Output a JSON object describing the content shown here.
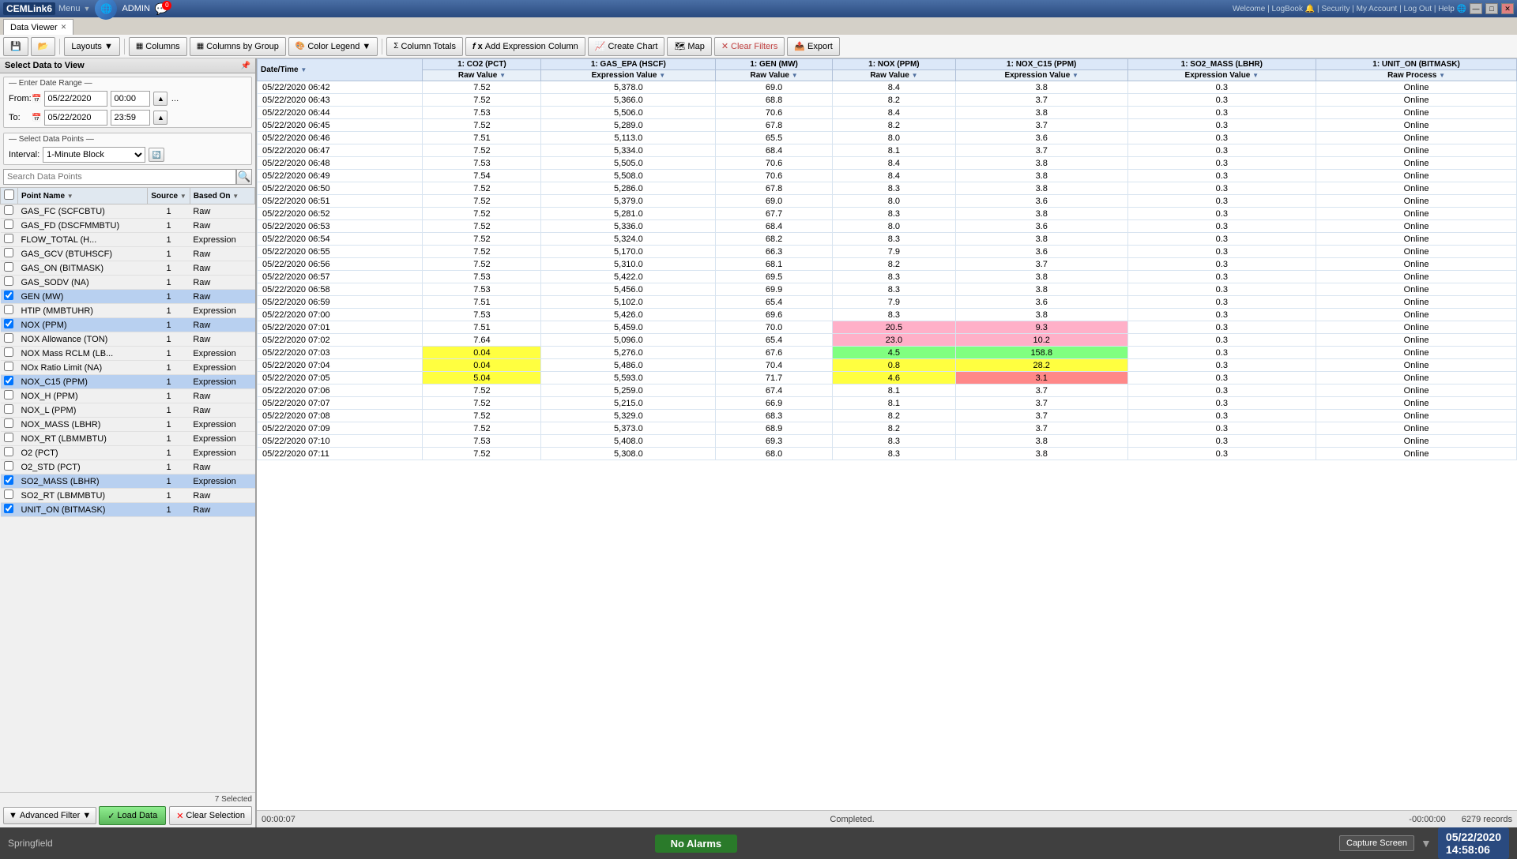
{
  "titlebar": {
    "app_name": "CEMLink6",
    "menu_label": "Menu",
    "user": "ADMIN",
    "notifications": "0",
    "welcome_links": "Welcome | LogBook 🔔 | Security | My Account | Log Out | Help 🌐",
    "min_btn": "—",
    "max_btn": "□",
    "close_btn": "✕"
  },
  "tab": {
    "label": "Data Viewer",
    "close": "✕"
  },
  "toolbar": {
    "layouts_label": "Layouts",
    "columns_label": "Columns",
    "columns_by_group_label": "Columns by Group",
    "color_legend_label": "Color Legend",
    "column_totals_label": "Column Totals",
    "add_expression_label": "Add Expression Column",
    "create_chart_label": "Create Chart",
    "map_label": "Map",
    "clear_filters_label": "Clear Filters",
    "export_label": "Export"
  },
  "left_panel": {
    "header": "Select Data to View",
    "date_range_label": "— Enter Date Range —",
    "from_label": "From:",
    "from_date": "05/22/2020",
    "from_time": "00:00",
    "to_label": "To:",
    "to_date": "05/22/2020",
    "to_time": "23:59",
    "select_dp_label": "— Select Data Points —",
    "interval_label": "Interval:",
    "interval_value": "1-Minute Block",
    "search_placeholder": "Search Data Points",
    "columns": {
      "point_name": "Point Name",
      "source": "Source",
      "based_on": "Based On"
    },
    "data_points": [
      {
        "name": "GAS_FC (SCFCBTU)",
        "source": "1",
        "based_on": "Raw",
        "selected": false
      },
      {
        "name": "GAS_FD (DSCFMMBTU)",
        "source": "1",
        "based_on": "Raw",
        "selected": false
      },
      {
        "name": "FLOW_TOTAL (H...",
        "source": "1",
        "based_on": "Expression",
        "selected": false
      },
      {
        "name": "GAS_GCV (BTUHSCF)",
        "source": "1",
        "based_on": "Raw",
        "selected": false
      },
      {
        "name": "GAS_ON (BITMASK)",
        "source": "1",
        "based_on": "Raw",
        "selected": false
      },
      {
        "name": "GAS_SODV (NA)",
        "source": "1",
        "based_on": "Raw",
        "selected": false
      },
      {
        "name": "GEN (MW)",
        "source": "1",
        "based_on": "Raw",
        "selected": true
      },
      {
        "name": "HTIP (MMBTUHR)",
        "source": "1",
        "based_on": "Expression",
        "selected": false
      },
      {
        "name": "NOX (PPM)",
        "source": "1",
        "based_on": "Raw",
        "selected": true
      },
      {
        "name": "NOX Allowance (TON)",
        "source": "1",
        "based_on": "Raw",
        "selected": false
      },
      {
        "name": "NOX Mass RCLM (LB...",
        "source": "1",
        "based_on": "Expression",
        "selected": false
      },
      {
        "name": "NOx Ratio Limit (NA)",
        "source": "1",
        "based_on": "Expression",
        "selected": false
      },
      {
        "name": "NOX_C15 (PPM)",
        "source": "1",
        "based_on": "Expression",
        "selected": true
      },
      {
        "name": "NOX_H (PPM)",
        "source": "1",
        "based_on": "Raw",
        "selected": false
      },
      {
        "name": "NOX_L (PPM)",
        "source": "1",
        "based_on": "Raw",
        "selected": false
      },
      {
        "name": "NOX_MASS (LBHR)",
        "source": "1",
        "based_on": "Expression",
        "selected": false
      },
      {
        "name": "NOX_RT (LBMMBTU)",
        "source": "1",
        "based_on": "Expression",
        "selected": false
      },
      {
        "name": "O2 (PCT)",
        "source": "1",
        "based_on": "Expression",
        "selected": false
      },
      {
        "name": "O2_STD (PCT)",
        "source": "1",
        "based_on": "Raw",
        "selected": false
      },
      {
        "name": "SO2_MASS (LBHR)",
        "source": "1",
        "based_on": "Expression",
        "selected": true
      },
      {
        "name": "SO2_RT (LBMMBTU)",
        "source": "1",
        "based_on": "Raw",
        "selected": false
      },
      {
        "name": "UNIT_ON (BITMASK)",
        "source": "1",
        "based_on": "Raw",
        "selected": true
      }
    ],
    "selected_count": "7 Selected",
    "adv_filter_label": "Advanced Filter",
    "load_btn_label": "Load Data",
    "clear_sel_label": "Clear Selection"
  },
  "grid": {
    "columns": [
      {
        "id": "datetime",
        "top": "Date/Time",
        "sub": ""
      },
      {
        "id": "co2_pct",
        "top": "1: CO2 (PCT)",
        "sub": "Raw Value"
      },
      {
        "id": "gas_epa",
        "top": "1: GAS_EPA (HSCF)",
        "sub": "Expression Value"
      },
      {
        "id": "gen_mw",
        "top": "1: GEN (MW)",
        "sub": "Raw Value"
      },
      {
        "id": "nox_ppm",
        "top": "1: NOX (PPM)",
        "sub": "Raw Value"
      },
      {
        "id": "nox_c15",
        "top": "1: NOX_C15 (PPM)",
        "sub": "Expression Value"
      },
      {
        "id": "so2_mass",
        "top": "1: SO2_MASS (LBHR)",
        "sub": "Expression Value"
      },
      {
        "id": "unit_on",
        "top": "1: UNIT_ON (BITMASK)",
        "sub": "Raw Process"
      }
    ],
    "rows": [
      {
        "datetime": "05/22/2020 06:42",
        "co2": "7.52",
        "gas_epa": "5,378.0",
        "gen": "69.0",
        "nox": "8.4",
        "nox_c15": "3.8",
        "so2": "0.3",
        "unit_on": "Online",
        "highlight": ""
      },
      {
        "datetime": "05/22/2020 06:43",
        "co2": "7.52",
        "gas_epa": "5,366.0",
        "gen": "68.8",
        "nox": "8.2",
        "nox_c15": "3.7",
        "so2": "0.3",
        "unit_on": "Online",
        "highlight": ""
      },
      {
        "datetime": "05/22/2020 06:44",
        "co2": "7.53",
        "gas_epa": "5,506.0",
        "gen": "70.6",
        "nox": "8.4",
        "nox_c15": "3.8",
        "so2": "0.3",
        "unit_on": "Online",
        "highlight": ""
      },
      {
        "datetime": "05/22/2020 06:45",
        "co2": "7.52",
        "gas_epa": "5,289.0",
        "gen": "67.8",
        "nox": "8.2",
        "nox_c15": "3.7",
        "so2": "0.3",
        "unit_on": "Online",
        "highlight": ""
      },
      {
        "datetime": "05/22/2020 06:46",
        "co2": "7.51",
        "gas_epa": "5,113.0",
        "gen": "65.5",
        "nox": "8.0",
        "nox_c15": "3.6",
        "so2": "0.3",
        "unit_on": "Online",
        "highlight": ""
      },
      {
        "datetime": "05/22/2020 06:47",
        "co2": "7.52",
        "gas_epa": "5,334.0",
        "gen": "68.4",
        "nox": "8.1",
        "nox_c15": "3.7",
        "so2": "0.3",
        "unit_on": "Online",
        "highlight": ""
      },
      {
        "datetime": "05/22/2020 06:48",
        "co2": "7.53",
        "gas_epa": "5,505.0",
        "gen": "70.6",
        "nox": "8.4",
        "nox_c15": "3.8",
        "so2": "0.3",
        "unit_on": "Online",
        "highlight": ""
      },
      {
        "datetime": "05/22/2020 06:49",
        "co2": "7.54",
        "gas_epa": "5,508.0",
        "gen": "70.6",
        "nox": "8.4",
        "nox_c15": "3.8",
        "so2": "0.3",
        "unit_on": "Online",
        "highlight": ""
      },
      {
        "datetime": "05/22/2020 06:50",
        "co2": "7.52",
        "gas_epa": "5,286.0",
        "gen": "67.8",
        "nox": "8.3",
        "nox_c15": "3.8",
        "so2": "0.3",
        "unit_on": "Online",
        "highlight": ""
      },
      {
        "datetime": "05/22/2020 06:51",
        "co2": "7.52",
        "gas_epa": "5,379.0",
        "gen": "69.0",
        "nox": "8.0",
        "nox_c15": "3.6",
        "so2": "0.3",
        "unit_on": "Online",
        "highlight": ""
      },
      {
        "datetime": "05/22/2020 06:52",
        "co2": "7.52",
        "gas_epa": "5,281.0",
        "gen": "67.7",
        "nox": "8.3",
        "nox_c15": "3.8",
        "so2": "0.3",
        "unit_on": "Online",
        "highlight": ""
      },
      {
        "datetime": "05/22/2020 06:53",
        "co2": "7.52",
        "gas_epa": "5,336.0",
        "gen": "68.4",
        "nox": "8.0",
        "nox_c15": "3.6",
        "so2": "0.3",
        "unit_on": "Online",
        "highlight": ""
      },
      {
        "datetime": "05/22/2020 06:54",
        "co2": "7.52",
        "gas_epa": "5,324.0",
        "gen": "68.2",
        "nox": "8.3",
        "nox_c15": "3.8",
        "so2": "0.3",
        "unit_on": "Online",
        "highlight": ""
      },
      {
        "datetime": "05/22/2020 06:55",
        "co2": "7.52",
        "gas_epa": "5,170.0",
        "gen": "66.3",
        "nox": "7.9",
        "nox_c15": "3.6",
        "so2": "0.3",
        "unit_on": "Online",
        "highlight": ""
      },
      {
        "datetime": "05/22/2020 06:56",
        "co2": "7.52",
        "gas_epa": "5,310.0",
        "gen": "68.1",
        "nox": "8.2",
        "nox_c15": "3.7",
        "so2": "0.3",
        "unit_on": "Online",
        "highlight": ""
      },
      {
        "datetime": "05/22/2020 06:57",
        "co2": "7.53",
        "gas_epa": "5,422.0",
        "gen": "69.5",
        "nox": "8.3",
        "nox_c15": "3.8",
        "so2": "0.3",
        "unit_on": "Online",
        "highlight": ""
      },
      {
        "datetime": "05/22/2020 06:58",
        "co2": "7.53",
        "gas_epa": "5,456.0",
        "gen": "69.9",
        "nox": "8.3",
        "nox_c15": "3.8",
        "so2": "0.3",
        "unit_on": "Online",
        "highlight": ""
      },
      {
        "datetime": "05/22/2020 06:59",
        "co2": "7.51",
        "gas_epa": "5,102.0",
        "gen": "65.4",
        "nox": "7.9",
        "nox_c15": "3.6",
        "so2": "0.3",
        "unit_on": "Online",
        "highlight": ""
      },
      {
        "datetime": "05/22/2020 07:00",
        "co2": "7.53",
        "gas_epa": "5,426.0",
        "gen": "69.6",
        "nox": "8.3",
        "nox_c15": "3.8",
        "so2": "0.3",
        "unit_on": "Online",
        "highlight": ""
      },
      {
        "datetime": "05/22/2020 07:01",
        "co2": "7.51",
        "gas_epa": "5,459.0",
        "gen": "70.0",
        "nox": "20.5",
        "nox_c15": "9.3",
        "so2": "0.3",
        "unit_on": "Online",
        "highlight": "pink"
      },
      {
        "datetime": "05/22/2020 07:02",
        "co2": "7.64",
        "gas_epa": "5,096.0",
        "gen": "65.4",
        "nox": "23.0",
        "nox_c15": "10.2",
        "so2": "0.3",
        "unit_on": "Online",
        "highlight": "pink"
      },
      {
        "datetime": "05/22/2020 07:03",
        "co2": "0.04",
        "gas_epa": "5,276.0",
        "gen": "67.6",
        "nox": "4.5",
        "nox_c15": "158.8",
        "so2": "0.3",
        "unit_on": "Online",
        "highlight": "green"
      },
      {
        "datetime": "05/22/2020 07:04",
        "co2": "0.04",
        "gas_epa": "5,486.0",
        "gen": "70.4",
        "nox": "0.8",
        "nox_c15": "28.2",
        "so2": "0.3",
        "unit_on": "Online",
        "highlight": "yellow"
      },
      {
        "datetime": "05/22/2020 07:05",
        "co2": "5.04",
        "gas_epa": "5,593.0",
        "gen": "71.7",
        "nox": "4.6",
        "nox_c15": "3.1",
        "so2": "0.3",
        "unit_on": "Online",
        "highlight": "yellow2"
      },
      {
        "datetime": "05/22/2020 07:06",
        "co2": "7.52",
        "gas_epa": "5,259.0",
        "gen": "67.4",
        "nox": "8.1",
        "nox_c15": "3.7",
        "so2": "0.3",
        "unit_on": "Online",
        "highlight": ""
      },
      {
        "datetime": "05/22/2020 07:07",
        "co2": "7.52",
        "gas_epa": "5,215.0",
        "gen": "66.9",
        "nox": "8.1",
        "nox_c15": "3.7",
        "so2": "0.3",
        "unit_on": "Online",
        "highlight": ""
      },
      {
        "datetime": "05/22/2020 07:08",
        "co2": "7.52",
        "gas_epa": "5,329.0",
        "gen": "68.3",
        "nox": "8.2",
        "nox_c15": "3.7",
        "so2": "0.3",
        "unit_on": "Online",
        "highlight": ""
      },
      {
        "datetime": "05/22/2020 07:09",
        "co2": "7.52",
        "gas_epa": "5,373.0",
        "gen": "68.9",
        "nox": "8.2",
        "nox_c15": "3.7",
        "so2": "0.3",
        "unit_on": "Online",
        "highlight": ""
      },
      {
        "datetime": "05/22/2020 07:10",
        "co2": "7.53",
        "gas_epa": "5,408.0",
        "gen": "69.3",
        "nox": "8.3",
        "nox_c15": "3.8",
        "so2": "0.3",
        "unit_on": "Online",
        "highlight": ""
      },
      {
        "datetime": "05/22/2020 07:11",
        "co2": "7.52",
        "gas_epa": "5,308.0",
        "gen": "68.0",
        "nox": "8.3",
        "nox_c15": "3.8",
        "so2": "0.3",
        "unit_on": "Online",
        "highlight": ""
      }
    ]
  },
  "status": {
    "elapsed": "00:00:07",
    "message": "Completed.",
    "time_right": "-00:00:00",
    "records": "6279 records"
  },
  "taskbar": {
    "location": "Springfield",
    "alarm_status": "No Alarms",
    "capture_label": "Capture Screen",
    "datetime": "05/22/2020",
    "time": "14:58:06"
  }
}
